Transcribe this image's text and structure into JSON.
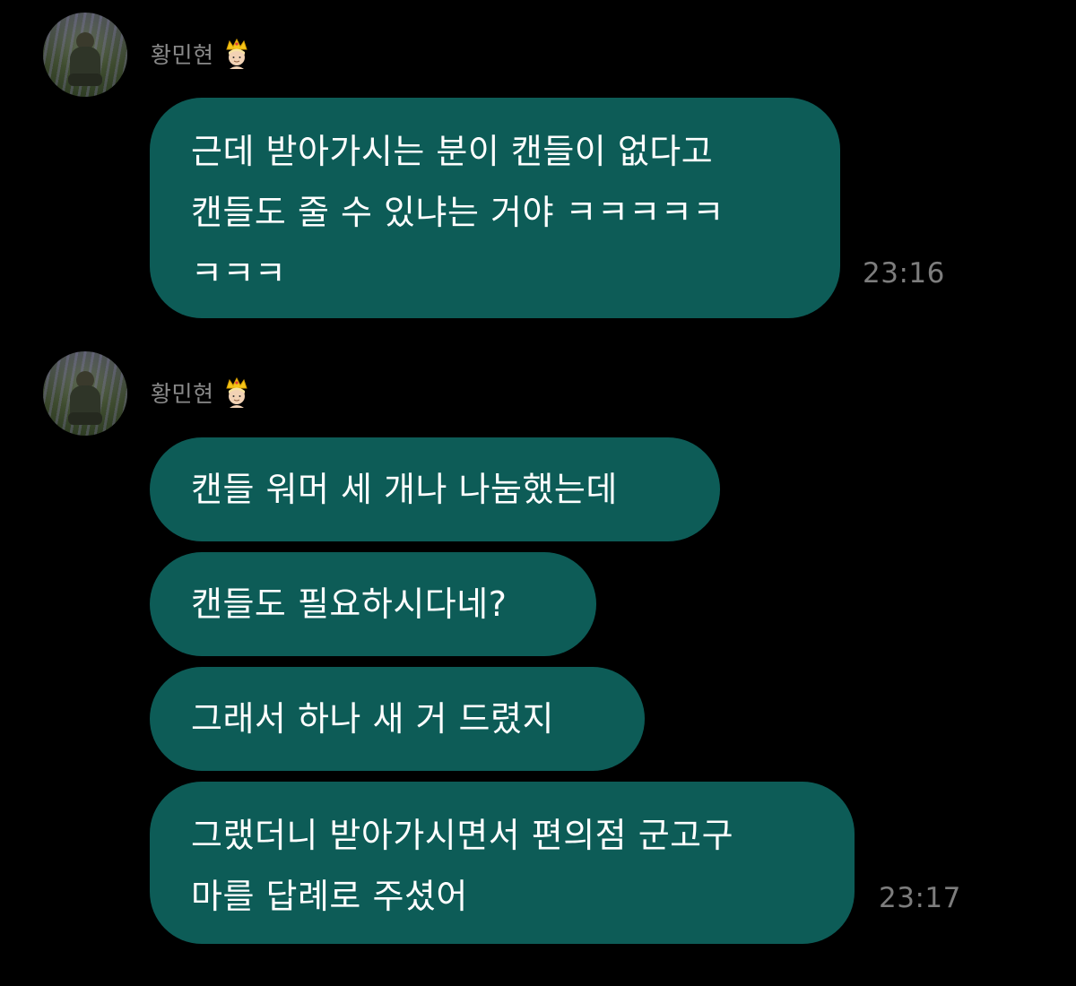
{
  "groups": [
    {
      "sender": {
        "name": "황민현",
        "badge_icon": "crown-person-emoji"
      },
      "messages": [
        {
          "lines": [
            "근데 받아가시는 분이 캔들이 없다고",
            "캔들도 줄 수 있냐는 거야 ㅋㅋㅋㅋㅋ",
            "ㅋㅋㅋ"
          ],
          "time": "23:16"
        }
      ]
    },
    {
      "sender": {
        "name": "황민현",
        "badge_icon": "crown-person-emoji"
      },
      "messages": [
        {
          "lines": [
            "캔들 워머 세 개나 나눔했는데"
          ],
          "time": ""
        },
        {
          "lines": [
            "캔들도 필요하시다네?"
          ],
          "time": ""
        },
        {
          "lines": [
            "그래서 하나 새 거 드렸지"
          ],
          "time": ""
        },
        {
          "lines": [
            "그랬더니 받아가시면서 편의점 군고구",
            "마를 답례로 주셨어"
          ],
          "time": "23:17"
        }
      ]
    }
  ],
  "colors": {
    "background": "#000000",
    "bubble": "#0d5c57",
    "message_text": "#ffffff",
    "sender_name": "#8a8a8a",
    "timestamp": "#7d7d7d"
  }
}
